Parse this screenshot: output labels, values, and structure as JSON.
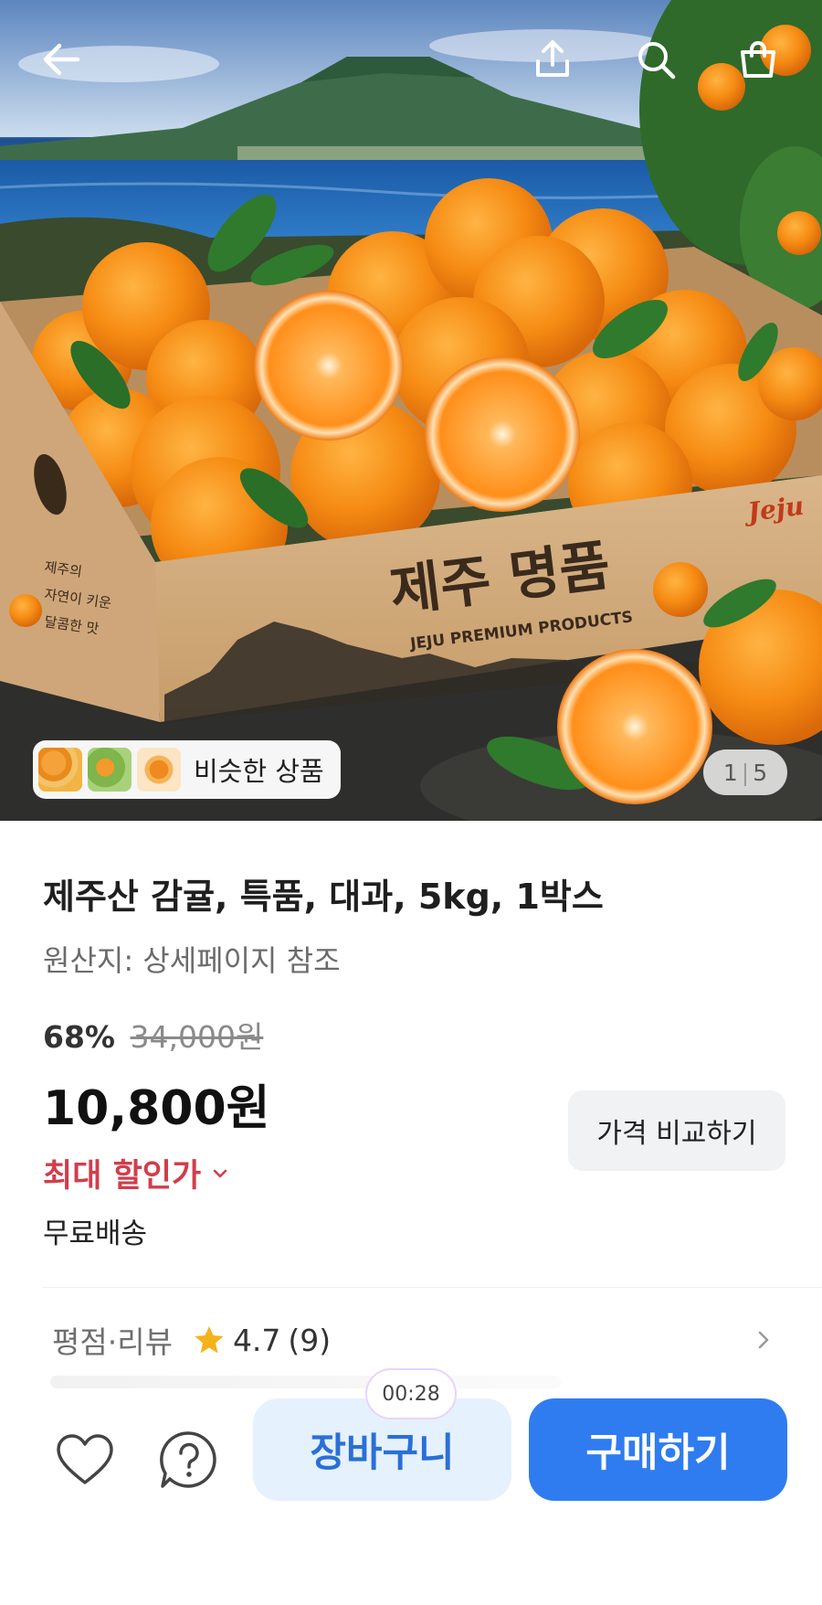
{
  "hero": {
    "box_print_title": "제주 명품",
    "box_print_subtitle": "JEJU PREMIUM PRODUCTS",
    "box_print_side": [
      "제주의",
      "자연이 키운",
      "달콤한 맛"
    ],
    "box_logo": "Jeju",
    "similar_label": "비슷한 상품",
    "page_current": "1",
    "page_total": "5"
  },
  "product": {
    "title": "제주산 감귤, 특품, 대과, 5kg, 1박스",
    "origin": "원산지: 상세페이지 참조",
    "discount_rate": "68%",
    "original_price": "34,000원",
    "price": "10,800원",
    "max_discount_label": "최대 할인가",
    "shipping": "무료배송",
    "compare_label": "가격 비교하기"
  },
  "review": {
    "label": "평점·리뷰",
    "rating": "4.7",
    "count": "(9)"
  },
  "bottom": {
    "timer": "00:28",
    "cart_label": "장바구니",
    "buy_label": "구매하기"
  },
  "colors": {
    "accent_blue": "#2f7cf0",
    "cart_bg": "#e6f1fe",
    "discount_red": "#d23d4c",
    "star": "#f5b21b"
  }
}
